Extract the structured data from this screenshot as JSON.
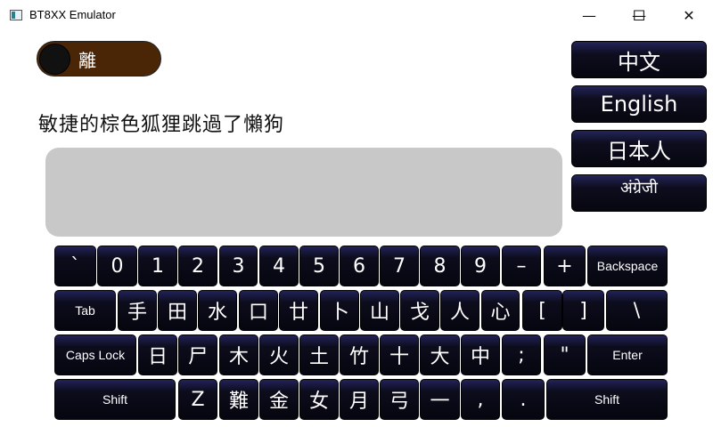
{
  "window": {
    "title": "BT8XX Emulator",
    "minimize_glyph": "—",
    "maximize_glyph": "☐",
    "close_glyph": "✕"
  },
  "toggle": {
    "label": "離",
    "state": "off"
  },
  "display_text": "敏捷的棕色狐狸跳過了懶狗",
  "input_area": {
    "value": ""
  },
  "languages": [
    "中文",
    "English",
    "日本人",
    "अंग्रेजी"
  ],
  "keyboard": {
    "rows": [
      [
        "`",
        "0",
        "1",
        "2",
        "3",
        "4",
        "5",
        "6",
        "7",
        "8",
        "9",
        "–",
        "+",
        "Backspace"
      ],
      [
        "Tab",
        "手",
        "田",
        "水",
        "口",
        "廿",
        "卜",
        "山",
        "戈",
        "人",
        "心",
        "[",
        "]",
        "\\"
      ],
      [
        "Caps Lock",
        "日",
        "尸",
        "木",
        "火",
        "土",
        "竹",
        "十",
        "大",
        "中",
        ";",
        "\"",
        "Enter"
      ],
      [
        "Shift",
        "Z",
        "難",
        "金",
        "女",
        "月",
        "弓",
        "一",
        ",",
        ".",
        "Shift"
      ]
    ]
  },
  "colors": {
    "toggle_track": "#4a2606",
    "text_area": "#c8c8c8",
    "key_top": "#22225a",
    "key_bottom": "#060610"
  }
}
